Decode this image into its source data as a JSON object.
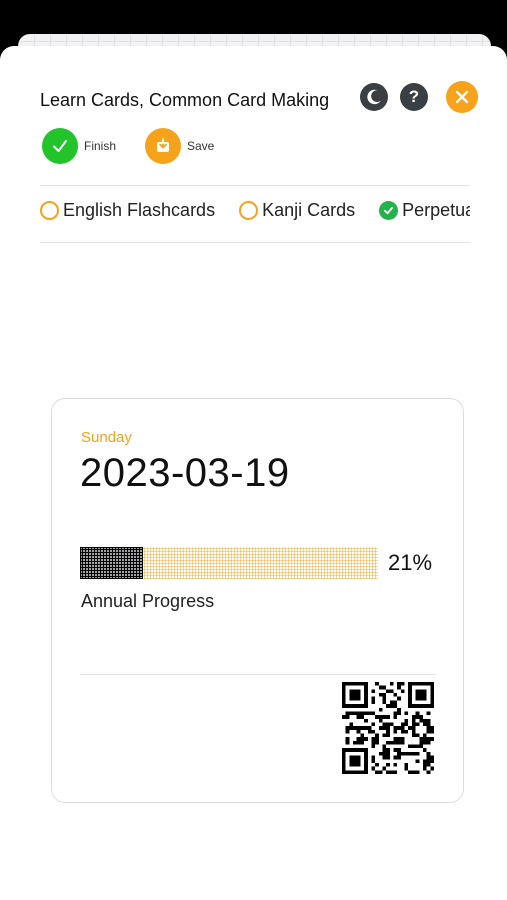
{
  "header": {
    "title": "Learn Cards, Common Card Making",
    "icons": {
      "theme": "moon-icon",
      "help": "question-mark-icon",
      "close": "close-icon"
    }
  },
  "actions": {
    "finish_label": "Finish",
    "save_label": "Save"
  },
  "tabs": [
    {
      "label": "English Flashcards",
      "checked": false
    },
    {
      "label": "Kanji Cards",
      "checked": false
    },
    {
      "label": "Perpetual",
      "checked": true
    }
  ],
  "card": {
    "weekday": "Sunday",
    "date": "2023-03-19",
    "progress": {
      "fraction": 0.21,
      "percent_text": "21%",
      "label": "Annual Progress"
    },
    "qr_icon": "qr-code-icon"
  },
  "colors": {
    "accent": "#f7a21b",
    "success": "#22c32b",
    "dark_icon": "#3a3f44"
  }
}
